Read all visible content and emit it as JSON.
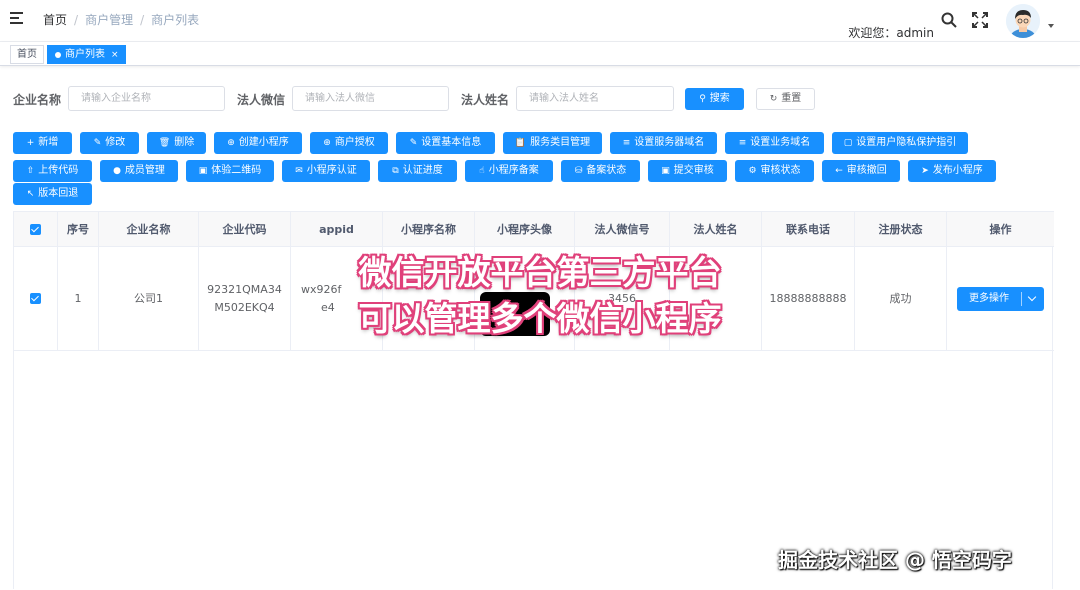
{
  "breadcrumb": [
    "首页",
    "商户管理",
    "商户列表"
  ],
  "header": {
    "welcome": "欢迎您：admin"
  },
  "tags": {
    "home": "首页",
    "active": "商户列表",
    "close": "×"
  },
  "search": {
    "company_label": "企业名称",
    "company_placeholder": "请输入企业名称",
    "wechat_label": "法人微信",
    "wechat_placeholder": "请输入法人微信",
    "name_label": "法人姓名",
    "name_placeholder": "请输入法人姓名",
    "search_btn": "搜索",
    "reset_btn": "重置"
  },
  "toolbar": {
    "row1": [
      "新增",
      "修改",
      "删除",
      "创建小程序",
      "商户授权",
      "设置基本信息",
      "服务类目管理",
      "设置服务器域名",
      "设置业务域名",
      "设置用户隐私保护指引"
    ],
    "row2": [
      "上传代码",
      "成员管理",
      "体验二维码",
      "小程序认证",
      "认证进度",
      "小程序备案",
      "备案状态",
      "提交审核",
      "审核状态",
      "审核撤回",
      "发布小程序"
    ],
    "row3": [
      "版本回退"
    ]
  },
  "table": {
    "headers": [
      "序号",
      "企业名称",
      "企业代码",
      "appid",
      "小程序名称",
      "小程序头像",
      "法人微信号",
      "法人姓名",
      "联系电话",
      "注册状态",
      "操作"
    ],
    "row": {
      "index": "1",
      "company": "公司1",
      "code_line1": "92321QMA34",
      "code_line2": "M502EKQ4",
      "appid_line1": "wx926f",
      "appid_line2": "e4",
      "wechat_partial": "3456",
      "phone": "18888888888",
      "status": "成功",
      "action": "更多操作"
    }
  },
  "overlay": {
    "line1": "微信开放平台第三方平台",
    "line2": "可以管理多个微信小程序"
  },
  "watermark": "掘金技术社区 @ 悟空码字",
  "colors": {
    "primary": "#1890ff",
    "overlay_stroke": "#e0407a"
  }
}
